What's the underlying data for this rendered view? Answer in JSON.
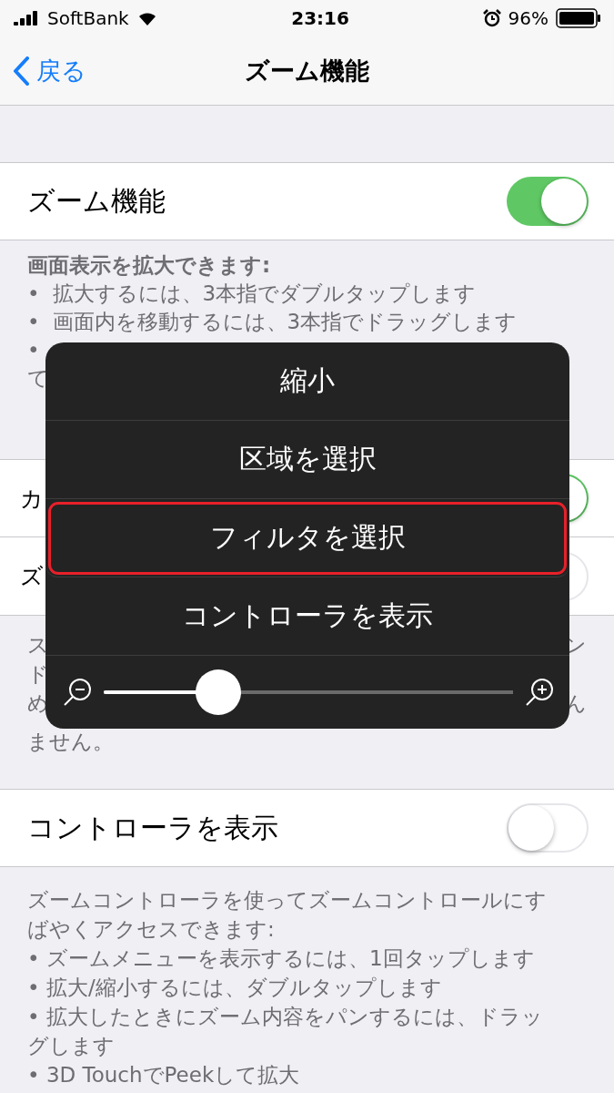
{
  "status_bar": {
    "carrier": "SoftBank",
    "time": "23:16",
    "battery": "96%"
  },
  "nav": {
    "back": "戻る",
    "title": "ズーム機能"
  },
  "zoom_row": {
    "label": "ズーム機能",
    "on": true
  },
  "zoom_footer": {
    "heading": "画面表示を拡大できます:",
    "lines": [
      {
        "bullet": "•",
        "text": "拡大するには、3本指でダブルタップします"
      },
      {
        "bullet": "•",
        "text": "画面内を移動するには、3本指でドラッグします"
      },
      {
        "bullet": "•"
      },
      {
        "text": "て"
      }
    ]
  },
  "group_rows": [
    {
      "label": "カ",
      "on": true
    },
    {
      "label": "ズ",
      "on": false
    }
  ],
  "group_footer": [
    {
      "left": "ス",
      "right": "ン"
    },
    {
      "left": "ド"
    },
    {
      "left": "め",
      "right": "ん"
    },
    {
      "left": "ません。"
    }
  ],
  "controller_row": {
    "label": "コントローラを表示",
    "on": false
  },
  "controller_footer": [
    "ズームコントローラを使ってズームコントロールにす",
    "ばやくアクセスできます:",
    "• ズームメニューを表示するには、1回タップします",
    "• 拡大/縮小するには、ダブルタップします",
    "• 拡大したときにズーム内容をパンするには、ドラッ",
    "グします",
    "• 3D TouchでPeekして拡大"
  ],
  "popup": {
    "items": [
      {
        "label": "縮小",
        "selected": false
      },
      {
        "label": "区域を選択",
        "selected": false
      },
      {
        "label": "フィルタを選択",
        "selected": true
      },
      {
        "label": "コントローラを表示",
        "selected": false
      }
    ],
    "slider": {
      "level": 0.28
    }
  }
}
